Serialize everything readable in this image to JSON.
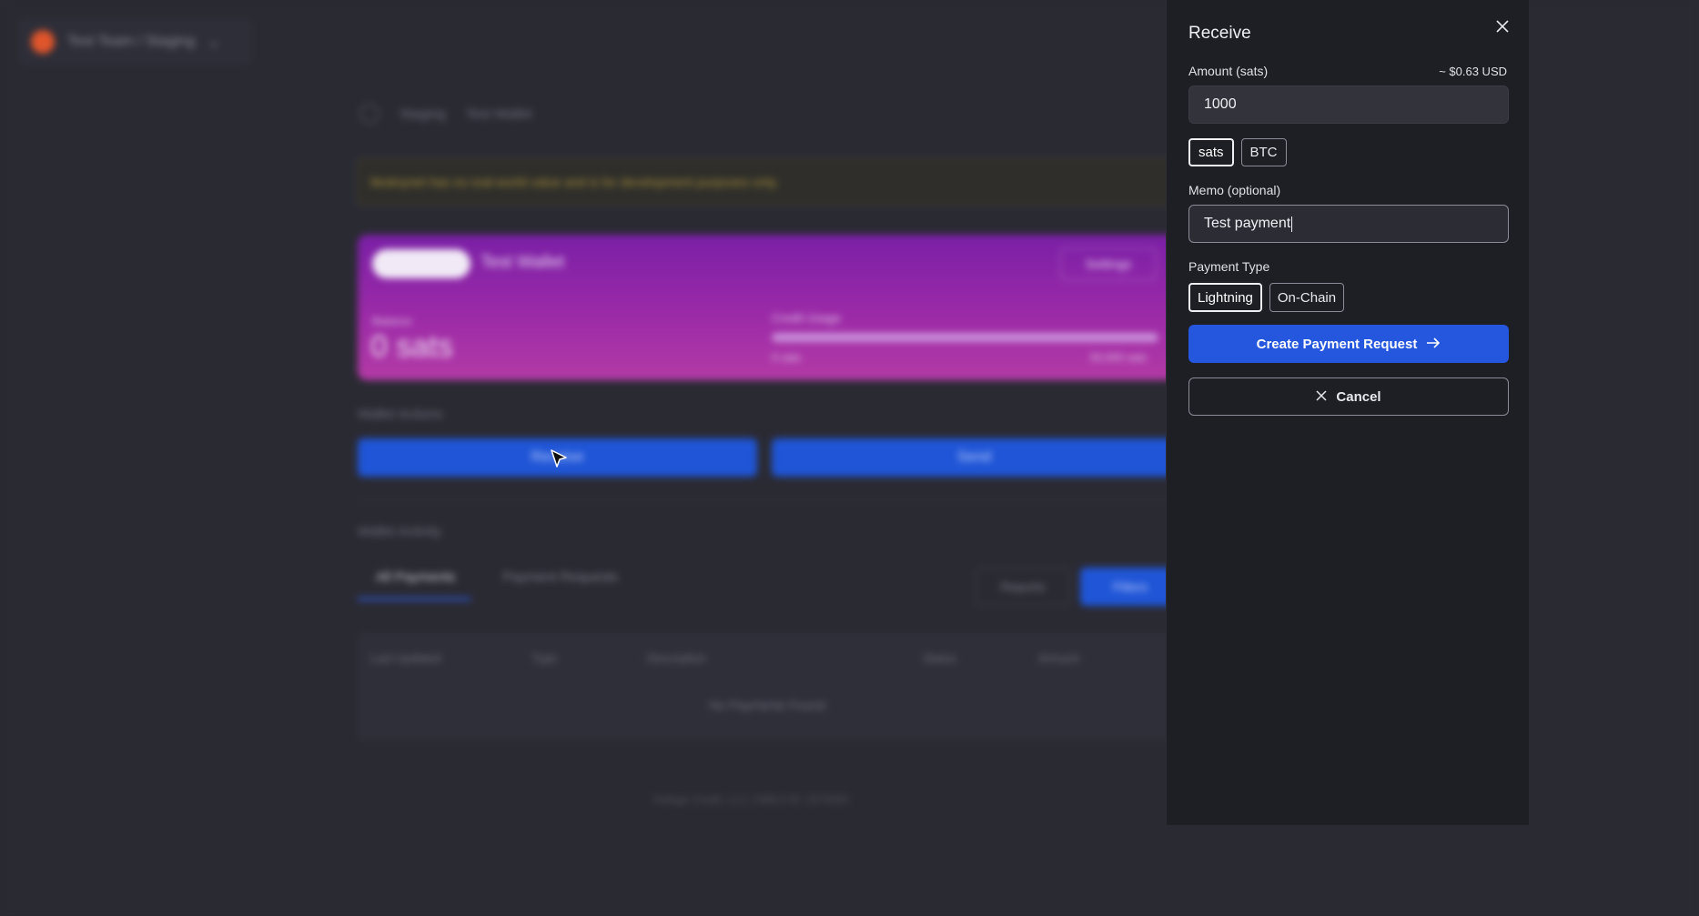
{
  "background": {
    "team_switcher": "Test Team / Staging",
    "breadcrumbs": [
      "Staging",
      "Test Wallet"
    ],
    "banner": "Mutinynet has no real-world value and is for development purposes only.",
    "wallet_card": {
      "network_pill": "Mutinynet",
      "wallet_name": "Test Wallet",
      "settings_label": "Settings",
      "balance_label": "Balance",
      "balance_value": "0 sats",
      "credit_usage_label": "Credit Usage",
      "credit_used": "0 sats",
      "credit_limit": "50,000 sats"
    },
    "actions_title": "Wallet Actions",
    "receive_label": "Receive",
    "send_label": "Send",
    "activity_title": "Wallet Activity",
    "tabs": [
      "All Payments",
      "Payment Requests"
    ],
    "reports_label": "Reports",
    "filters_label": "Filters",
    "table_headers": [
      "Last Updated",
      "Type",
      "Description",
      "Status",
      "Amount"
    ],
    "empty_text": "No Payments Found",
    "footer": "Voltage Credit, LLC | NMLS ID: 2575550"
  },
  "panel": {
    "title": "Receive",
    "amount_label": "Amount (sats)",
    "amount_usd": "~ $0.63 USD",
    "amount_value": "1000",
    "units": [
      "sats",
      "BTC"
    ],
    "selected_unit": "sats",
    "memo_label": "Memo (optional)",
    "memo_value": "Test payment",
    "payment_type_label": "Payment Type",
    "payment_types": [
      "Lightning",
      "On-Chain"
    ],
    "selected_payment_type": "Lightning",
    "create_label": "Create Payment Request",
    "cancel_label": "Cancel"
  },
  "icons": {
    "close": "close-icon",
    "arrow": "arrow-right-icon",
    "cancel": "x-icon",
    "cursor": "mouse-pointer-icon"
  },
  "colors": {
    "primary": "#2457de",
    "panel_bg": "#1e1e25",
    "page_bg": "#2a2a33",
    "card_gradient_start": "#7a1fa6",
    "card_gradient_end": "#b33aa6"
  }
}
